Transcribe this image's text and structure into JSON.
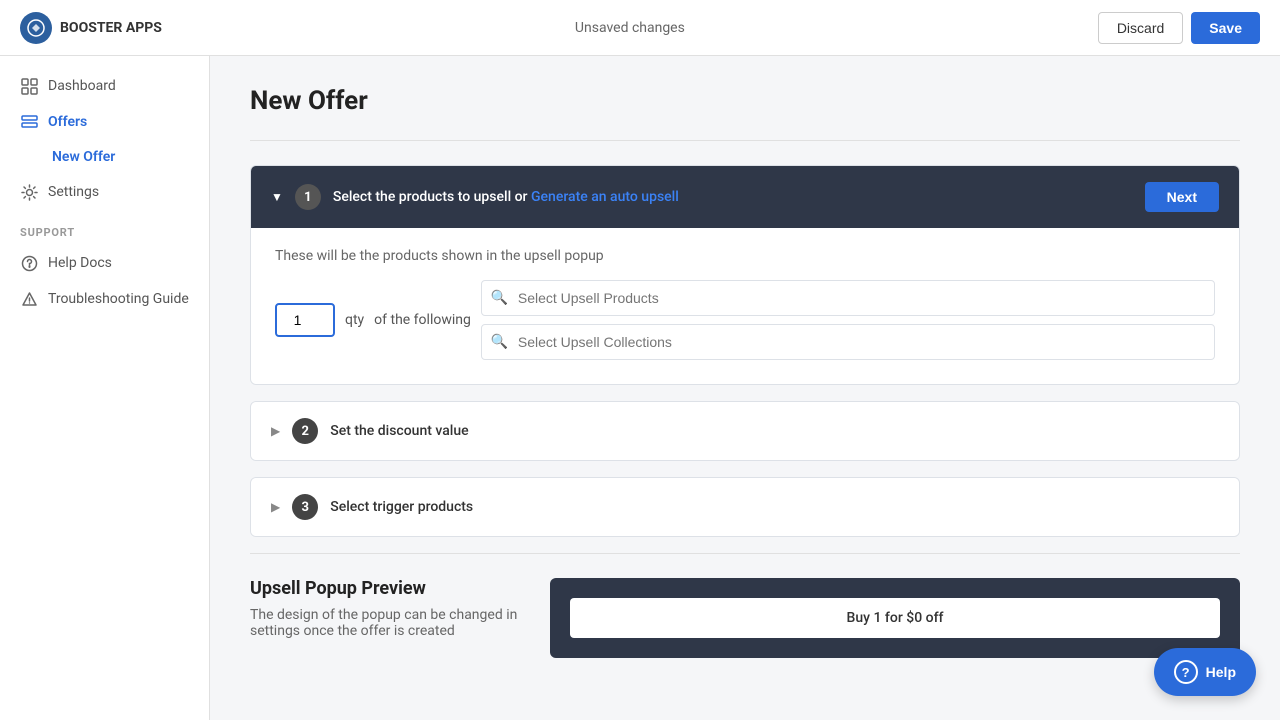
{
  "topbar": {
    "logo_text": "BOOSTER APPS",
    "unsaved_label": "Unsaved changes",
    "discard_label": "Discard",
    "save_label": "Save"
  },
  "sidebar": {
    "nav_items": [
      {
        "id": "dashboard",
        "label": "Dashboard",
        "active": false
      },
      {
        "id": "offers",
        "label": "Offers",
        "active": true
      },
      {
        "id": "new-offer",
        "label": "New Offer",
        "sub": true
      },
      {
        "id": "settings",
        "label": "Settings",
        "active": false
      }
    ],
    "support_label": "SUPPORT",
    "support_items": [
      {
        "id": "help-docs",
        "label": "Help Docs"
      },
      {
        "id": "troubleshooting",
        "label": "Troubleshooting Guide"
      }
    ]
  },
  "page": {
    "title": "New Offer"
  },
  "steps": [
    {
      "number": "1",
      "title_prefix": "Select the products to upsell or ",
      "title_link": "Generate an auto upsell",
      "expanded": true,
      "description": "These will be the products shown in the upsell popup",
      "qty_value": "1",
      "qty_label": "qty",
      "of_label": "of the following",
      "products_placeholder": "Select Upsell Products",
      "collections_placeholder": "Select Upsell Collections",
      "next_label": "Next"
    },
    {
      "number": "2",
      "title": "Set the discount value",
      "expanded": false
    },
    {
      "number": "3",
      "title": "Select trigger products",
      "expanded": false
    }
  ],
  "preview": {
    "title": "Upsell Popup Preview",
    "description": "The design of the popup can be changed in settings once the offer is created",
    "preview_text": "Buy 1 for $0 off"
  },
  "help": {
    "label": "Help"
  }
}
